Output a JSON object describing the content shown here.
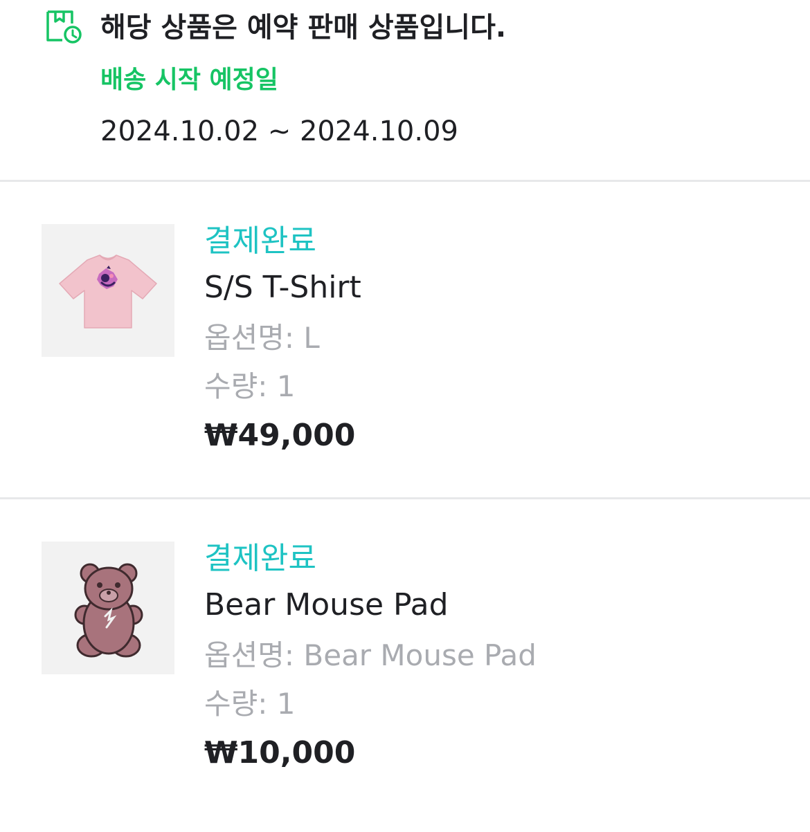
{
  "preorder": {
    "title": "해당 상품은 예약 판매 상품입니다.",
    "ship_label": "배송 시작 예정일",
    "ship_range": "2024.10.02 ~ 2024.10.09",
    "icon": "box-clock-icon",
    "accent_color": "#16c464"
  },
  "items": [
    {
      "status": "결제완료",
      "name": "S/S T-Shirt",
      "option_label": "옵션명: L",
      "quantity_label": "수량: 1",
      "price": "₩49,000"
    },
    {
      "status": "결제완료",
      "name": "Bear Mouse Pad",
      "option_label": "옵션명: Bear Mouse Pad",
      "quantity_label": "수량: 1",
      "price": "₩10,000"
    }
  ],
  "colors": {
    "status": "#1ec3c3",
    "muted_text": "#a9abb0",
    "divider": "#e7e8ea"
  }
}
